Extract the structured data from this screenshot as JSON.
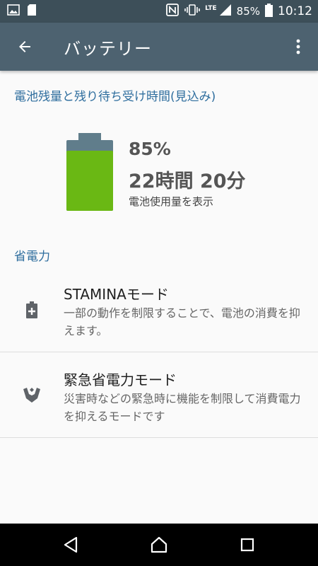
{
  "status_bar": {
    "battery_text": "85%",
    "network_label": "LTE",
    "time": "10:12",
    "icons": [
      "image-icon",
      "sd-card-icon",
      "nfc-icon",
      "vibrate-icon",
      "signal-icon",
      "battery-icon"
    ]
  },
  "app_bar": {
    "title": "バッテリー",
    "icons": [
      "back-arrow-icon",
      "more-vert-icon"
    ]
  },
  "battery_section": {
    "header": "電池残量と残り待ち受け時間(見込み)",
    "percent": "85%",
    "level": 0.85,
    "remaining_time": "22時間 20分",
    "usage_link": "電池使用量を表示",
    "fill_color": "#6ab814"
  },
  "power_saving": {
    "header": "省電力",
    "items": [
      {
        "title": "STAMINAモード",
        "description": "一部の動作を制限することで、電池の消費を抑えます。",
        "icon": "battery-plus-icon"
      },
      {
        "title": "緊急省電力モード",
        "description": "災害時などの緊急時に機能を制限して消費電力を抑えるモードです",
        "icon": "emergency-hands-icon"
      }
    ]
  },
  "nav_bar": {
    "icons": [
      "back-triangle-icon",
      "home-icon",
      "recents-icon"
    ]
  }
}
